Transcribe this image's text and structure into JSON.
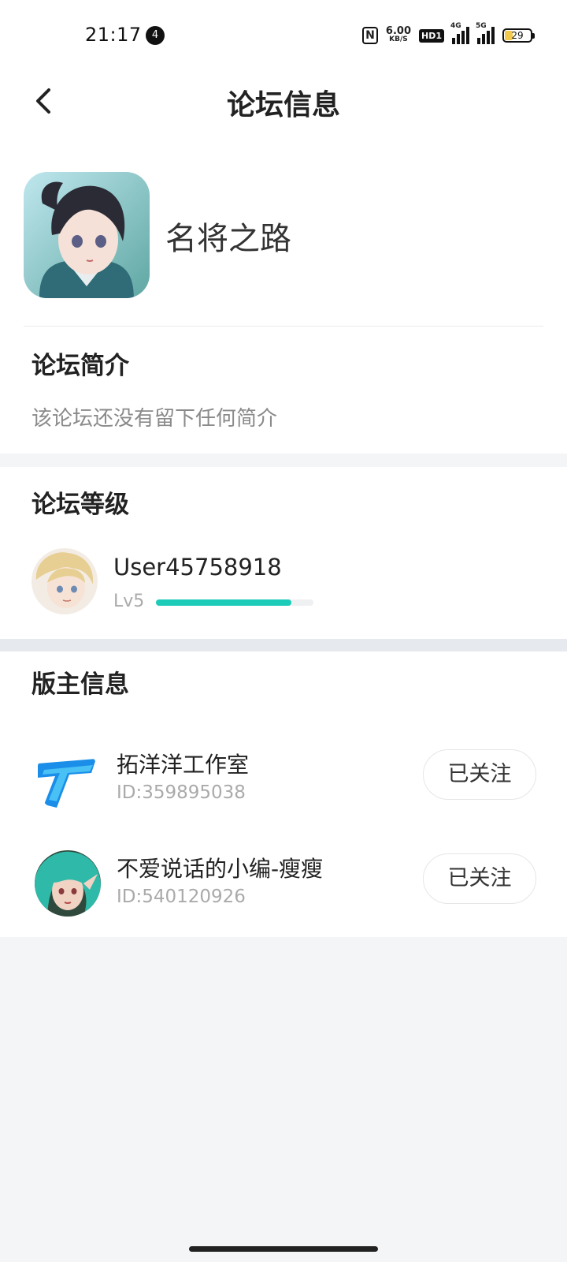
{
  "status_bar": {
    "time": "21:17",
    "notification_count": "4",
    "net_speed_value": "6.00",
    "net_speed_unit": "KB/S",
    "hd_label": "HD1",
    "sim1_tech": "4G",
    "sim2_tech": "5G",
    "battery_level": "29"
  },
  "header": {
    "title": "论坛信息",
    "back_icon": "chevron-left-icon"
  },
  "forum": {
    "name": "名将之路",
    "icon": "forum-avatar-image"
  },
  "intro": {
    "title": "论坛简介",
    "text": "该论坛还没有留下任何简介"
  },
  "level": {
    "title": "论坛等级",
    "user_name": "User45758918",
    "level_label": "Lv5",
    "progress_percent": 86,
    "accent_color": "#1ccbb8"
  },
  "moderators": {
    "title": "版主信息",
    "items": [
      {
        "name": "拓洋洋工作室",
        "id": "ID:359895038",
        "button": "已关注",
        "avatar": "tuoyang-logo-icon"
      },
      {
        "name": "不爱说话的小编-瘦瘦",
        "id": "ID:540120926",
        "button": "已关注",
        "avatar": "moderator-avatar-image"
      }
    ]
  }
}
